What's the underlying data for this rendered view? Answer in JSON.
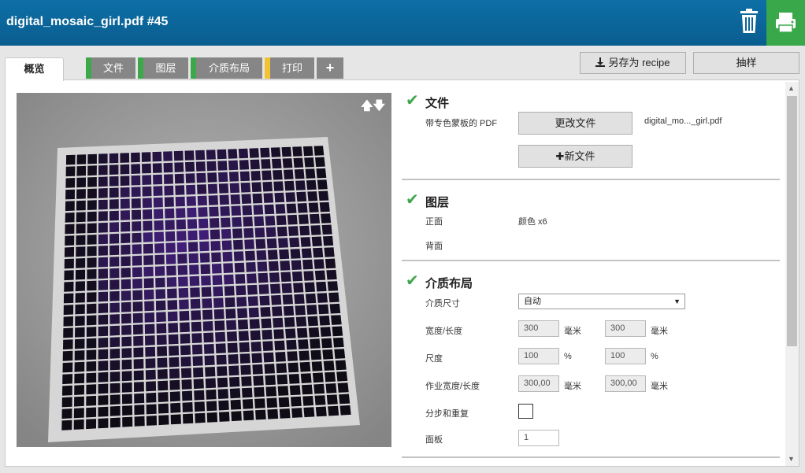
{
  "header": {
    "title": "digital_mosaic_girl.pdf #45"
  },
  "tabs": {
    "overview": "概览",
    "items": [
      {
        "label": "文件",
        "status_color": "#3da84a"
      },
      {
        "label": "图层",
        "status_color": "#3da84a"
      },
      {
        "label": "介质布局",
        "status_color": "#3da84a"
      },
      {
        "label": "打印",
        "status_color": "#f2c230"
      }
    ],
    "add_label": "+"
  },
  "toolbar": {
    "save_recipe": "另存为 recipe",
    "sample": "抽样"
  },
  "sections": {
    "file": {
      "title": "文件",
      "spot_pdf_label": "带专色蒙板的 PDF",
      "change_file": "更改文件",
      "new_file": "新文件",
      "file_name": "digital_mo..._girl.pdf"
    },
    "layers": {
      "title": "图层",
      "front_label": "正面",
      "front_value": "颜色 x6",
      "back_label": "背面"
    },
    "media_layout": {
      "title": "介质布局",
      "media_size_label": "介质尺寸",
      "media_size_value": "自动",
      "width_length_label": "宽度/长度",
      "width": "300",
      "length": "300",
      "unit_mm": "毫米",
      "scale_label": "尺度",
      "scale_x": "100",
      "scale_y": "100",
      "unit_pct": "%",
      "job_size_label": "作业宽度/长度",
      "job_width": "300,00",
      "job_length": "300,00",
      "step_repeat_label": "分步和重复",
      "panels_label": "面板",
      "panels_value": "1"
    }
  },
  "colors": {
    "header": "#0a5d8f",
    "accent_green": "#3da84a",
    "accent_yellow": "#f2c230"
  }
}
